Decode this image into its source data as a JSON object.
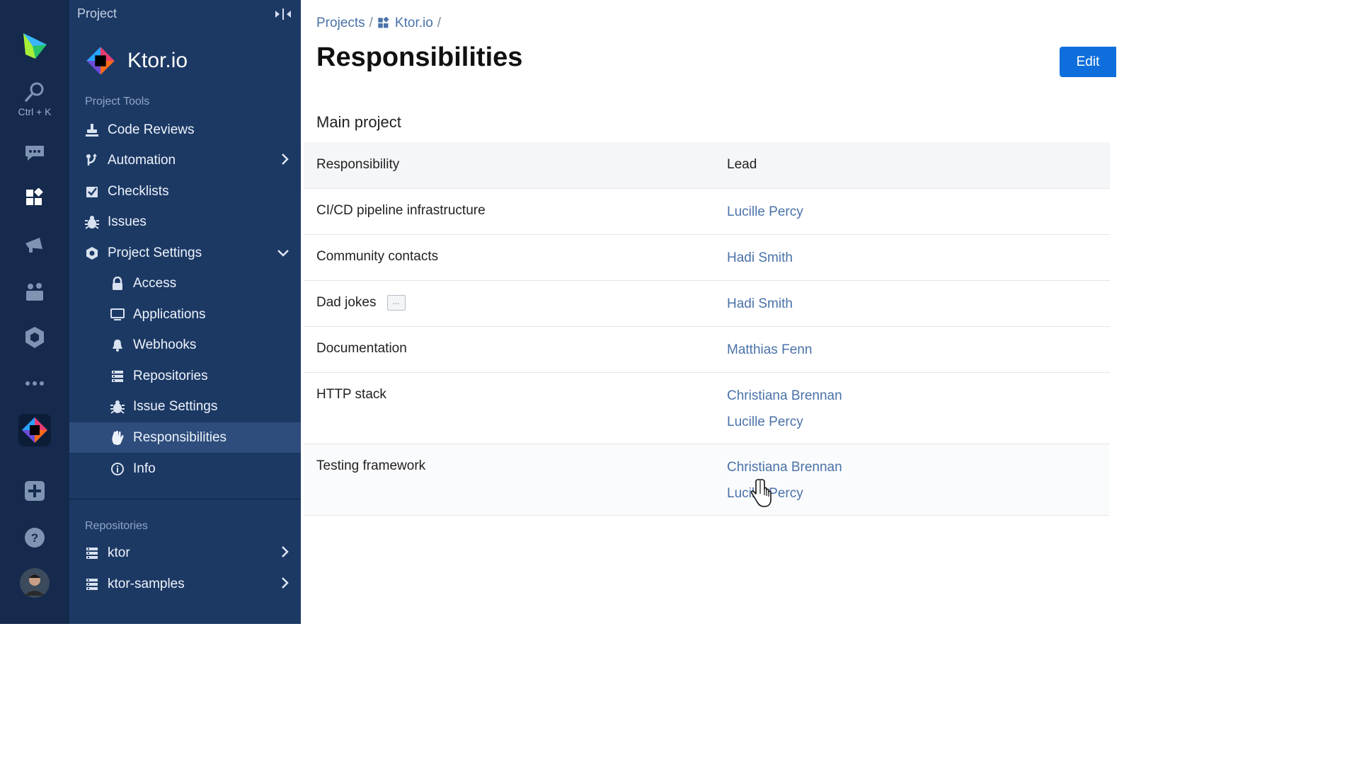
{
  "rail": {
    "search_hint": "Ctrl + K",
    "items": [
      "logo-icon",
      "search-icon",
      "chat-icon",
      "projects-icon",
      "megaphone-icon",
      "team-icon",
      "packages-icon",
      "more-icon",
      "ktor-project-icon",
      "add-icon",
      "help-icon",
      "avatar"
    ]
  },
  "panel": {
    "header": "Project",
    "project_name": "Ktor.io",
    "tools_label": "Project Tools",
    "tools": [
      {
        "label": "Code Reviews",
        "icon": "code-review-icon"
      },
      {
        "label": "Automation",
        "icon": "automation-icon"
      },
      {
        "label": "Checklists",
        "icon": "checklist-icon"
      },
      {
        "label": "Issues",
        "icon": "bug-icon"
      },
      {
        "label": "Project Settings",
        "icon": "settings-icon"
      }
    ],
    "settings": [
      {
        "label": "Access",
        "icon": "lock-icon"
      },
      {
        "label": "Applications",
        "icon": "monitor-icon"
      },
      {
        "label": "Webhooks",
        "icon": "bell-icon"
      },
      {
        "label": "Repositories",
        "icon": "repo-icon"
      },
      {
        "label": "Issue Settings",
        "icon": "bug-icon"
      },
      {
        "label": "Responsibilities",
        "icon": "hand-icon",
        "active": true
      },
      {
        "label": "Info",
        "icon": "info-icon"
      }
    ],
    "repos_label": "Repositories",
    "repos": [
      {
        "label": "ktor"
      },
      {
        "label": "ktor-samples"
      }
    ]
  },
  "main": {
    "breadcrumb": {
      "projects": "Projects",
      "sep1": "/",
      "project": "Ktor.io",
      "sep2": "/"
    },
    "title": "Responsibilities",
    "edit_label": "Edit",
    "section_title": "Main project",
    "columns": {
      "responsibility": "Responsibility",
      "lead": "Lead"
    },
    "rows": [
      {
        "responsibility": "CI/CD pipeline infrastructure",
        "leads": [
          "Lucille Percy"
        ]
      },
      {
        "responsibility": "Community contacts",
        "leads": [
          "Hadi Smith"
        ]
      },
      {
        "responsibility": "Dad jokes",
        "leads": [
          "Hadi Smith"
        ],
        "more": "..."
      },
      {
        "responsibility": "Documentation",
        "leads": [
          "Matthias Fenn"
        ]
      },
      {
        "responsibility": "HTTP stack",
        "leads": [
          "Christiana Brennan",
          "Lucille Percy"
        ]
      },
      {
        "responsibility": "Testing framework",
        "leads": [
          "Christiana Brennan",
          "Lucille Percy"
        ]
      }
    ]
  },
  "colors": {
    "rail": "#152a4d",
    "panel": "#1c3964",
    "active": "#2e4d7c",
    "link": "#4a72a8",
    "accent": "#0e6fdc"
  }
}
